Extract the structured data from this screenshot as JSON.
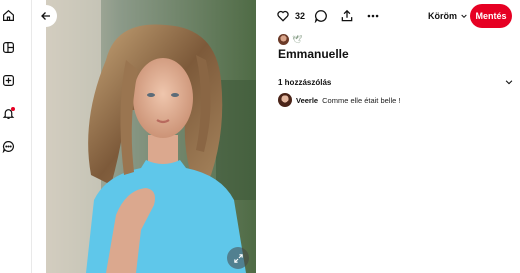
{
  "nav": {
    "items": [
      {
        "icon": "home-icon"
      },
      {
        "icon": "explore-icon"
      },
      {
        "icon": "create-icon"
      },
      {
        "icon": "notifications-icon",
        "badge_color": "#e60023"
      },
      {
        "icon": "messages-icon"
      }
    ]
  },
  "pin": {
    "likes": "32",
    "board_label": "Köröm",
    "save_label": "Mentés",
    "title": "Emmanuelle",
    "creator_badge": "🕊"
  },
  "comments": {
    "header": "1 hozzászólás",
    "items": [
      {
        "author": "Veerle",
        "text": "Comme elle était belle !"
      }
    ]
  },
  "colors": {
    "accent": "#e60023",
    "top_color": "#5fc7ea"
  }
}
